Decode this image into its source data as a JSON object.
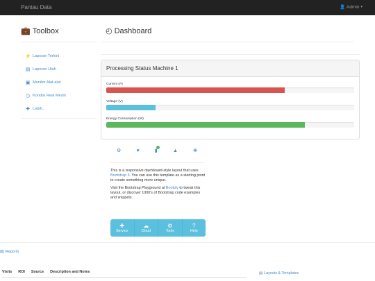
{
  "navbar": {
    "brand": "Pantau Data",
    "user": "Admin"
  },
  "toolbox": {
    "title": "Toolbox"
  },
  "dashboard": {
    "title": "Dashboard"
  },
  "sidebar": {
    "items": [
      {
        "label": "Laporan Terkini",
        "icon": "bolt-icon"
      },
      {
        "label": "Laporan Utuh",
        "icon": "list-icon"
      },
      {
        "label": "Monitor Alat-alat",
        "icon": "briefcase-icon"
      },
      {
        "label": "Kondisi Real Mesin",
        "icon": "clock-icon"
      },
      {
        "label": "Lebih..",
        "icon": "plus-icon"
      }
    ]
  },
  "panel": {
    "title": "Processing Status Machine 1",
    "meters": [
      {
        "label": "Current (A)",
        "level": 0.72,
        "color": "#d9534f"
      },
      {
        "label": "Voltage (V)",
        "level": 0.2,
        "color": "#5bc0de"
      },
      {
        "label": "Energy Consumption (W)",
        "level": 0.8,
        "color": "#5cb85c"
      }
    ]
  },
  "info": {
    "p1_a": "This is a responsive dashboard-style layout that uses ",
    "p1_link": "Bootstrap 3",
    "p1_b": ". You can use this template as a starting point to create something more unique.",
    "p2_a": "Visit the Bootstrap Playground at ",
    "p2_link": "Bootply",
    "p2_b": " to tweak this layout, or discover 1000's of Bootstrap code examples and snippets."
  },
  "actions": [
    {
      "label": "Service",
      "icon": "plus-icon"
    },
    {
      "label": "Cloud",
      "icon": "cloud-icon"
    },
    {
      "label": "Tools",
      "icon": "cog-icon"
    },
    {
      "label": "Help",
      "icon": "question-icon"
    }
  ],
  "reports": {
    "label": "Reports"
  },
  "table": {
    "headers": [
      "Visits",
      "ROI",
      "Source",
      "Description and Notes"
    ]
  },
  "layouts": {
    "label": "Layouts & Templates"
  },
  "colors": {
    "accent": "#428bca",
    "navbar": "#222222",
    "info": "#5bc0de"
  }
}
